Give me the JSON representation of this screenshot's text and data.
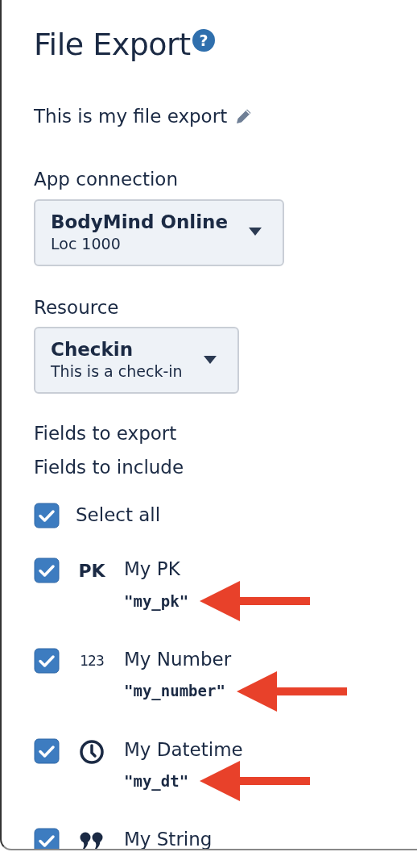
{
  "title": "File Export",
  "help_icon": "?",
  "description": "This is my file export",
  "app_connection": {
    "label": "App connection",
    "value": "BodyMind Online",
    "detail": "Loc 1000"
  },
  "resource": {
    "label": "Resource",
    "value": "Checkin",
    "detail": "This is a check-in"
  },
  "fields_to_export_label": "Fields to export",
  "fields_to_include_label": "Fields to include",
  "select_all": {
    "label": "Select all",
    "checked": true
  },
  "fields": [
    {
      "kind": "text-badge",
      "badge": "PK",
      "name": "My PK",
      "api_name": "\"my_pk\"",
      "checked": true,
      "annotated": true
    },
    {
      "kind": "number-badge",
      "badge": "123",
      "name": "My Number",
      "api_name": "\"my_number\"",
      "checked": true,
      "annotated": true
    },
    {
      "kind": "clock",
      "name": "My Datetime",
      "api_name": "\"my_dt\"",
      "checked": true,
      "annotated": true
    },
    {
      "kind": "quote",
      "name": "My String",
      "checked": true,
      "annotated": false
    }
  ]
}
